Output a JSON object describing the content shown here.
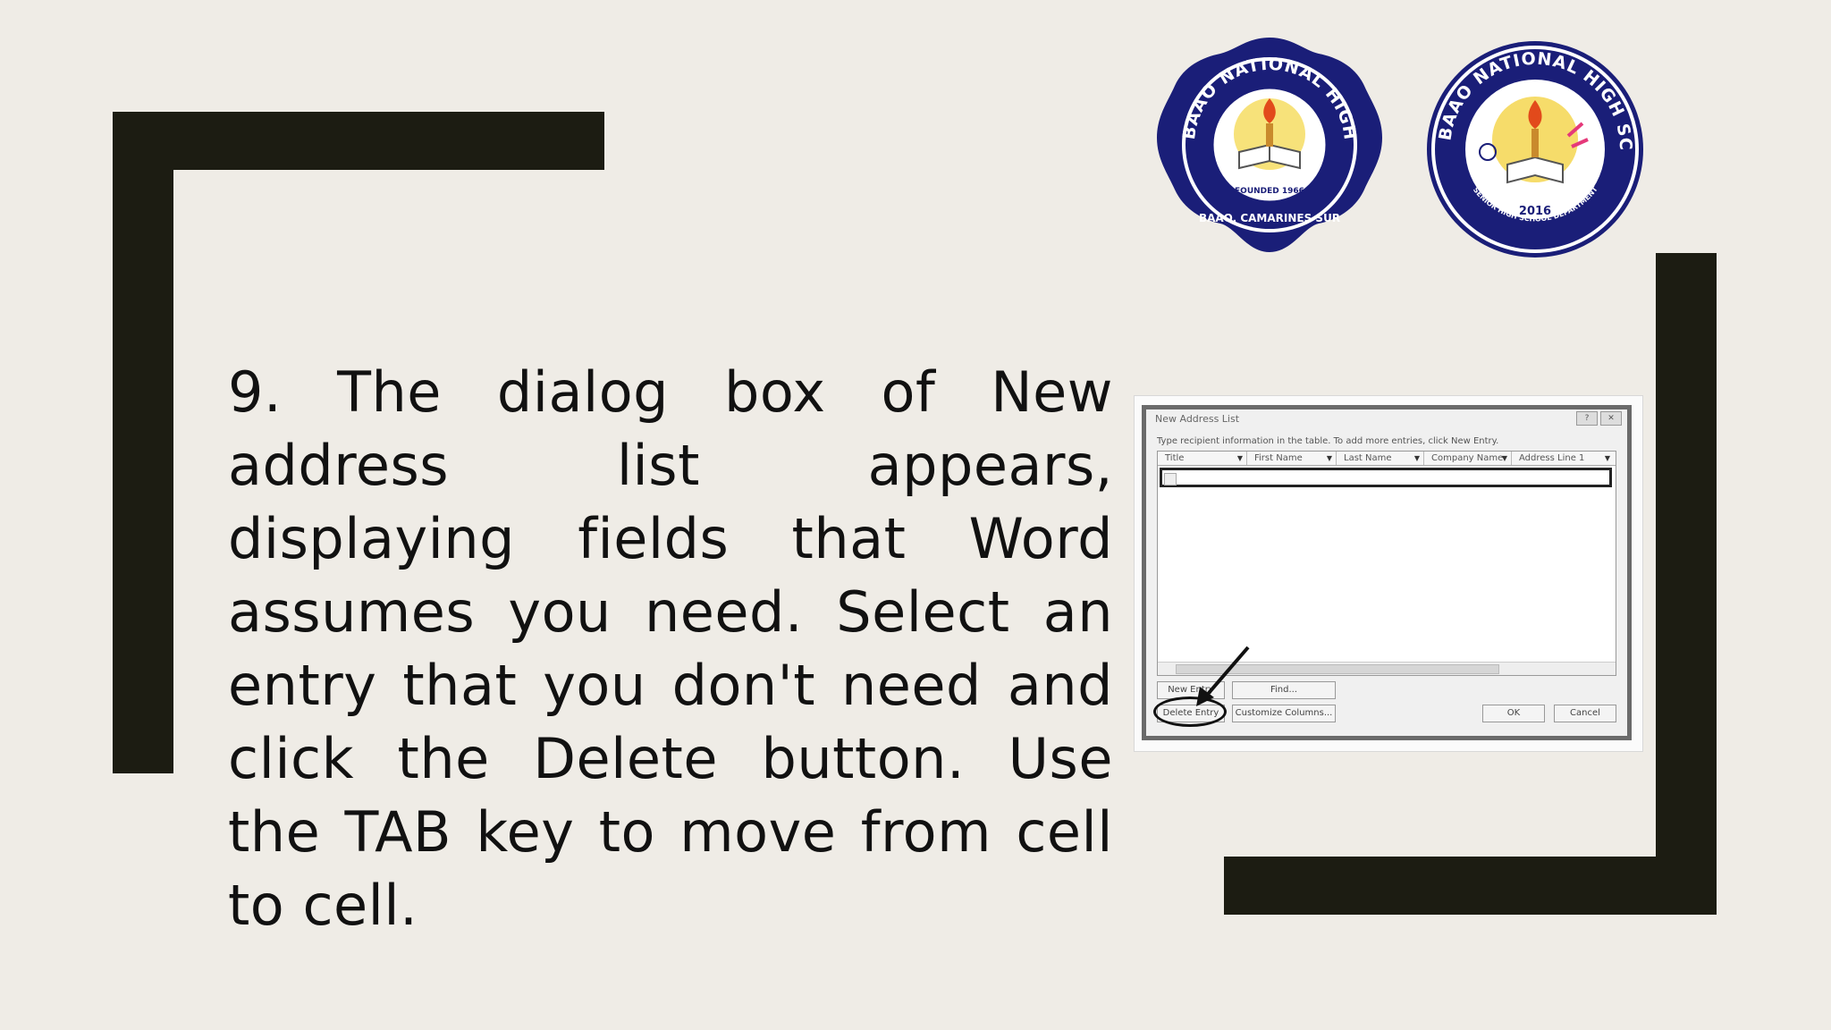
{
  "slide": {
    "body_text": "9. The dialog box of New address list appears, displaying fields that Word assumes you need. Select an entry that you don't need and click the Delete button. Use the TAB key to move from cell to cell."
  },
  "logos": {
    "left": {
      "name": "BAAO NATIONAL HIGH SCHOOL",
      "founded": "FOUNDED 1966",
      "place": "BAAO, CAMARINES SUR"
    },
    "right": {
      "name": "BAAO NATIONAL HIGH SCHOOL",
      "year": "2016",
      "department": "SENIOR HIGH SCHOOL DEPARTMENT"
    }
  },
  "dialog": {
    "title": "New Address List",
    "instruction": "Type recipient information in the table. To add more entries, click New Entry.",
    "columns": [
      "Title",
      "First Name",
      "Last Name",
      "Company Name",
      "Address Line 1"
    ],
    "buttons": {
      "new_entry": "New Entry",
      "find": "Find...",
      "delete_entry": "Delete Entry",
      "customize_columns": "Customize Columns...",
      "ok": "OK",
      "cancel": "Cancel"
    }
  },
  "colors": {
    "background": "#efece6",
    "frame": "#1c1c12",
    "logo_blue": "#1a1e78"
  }
}
